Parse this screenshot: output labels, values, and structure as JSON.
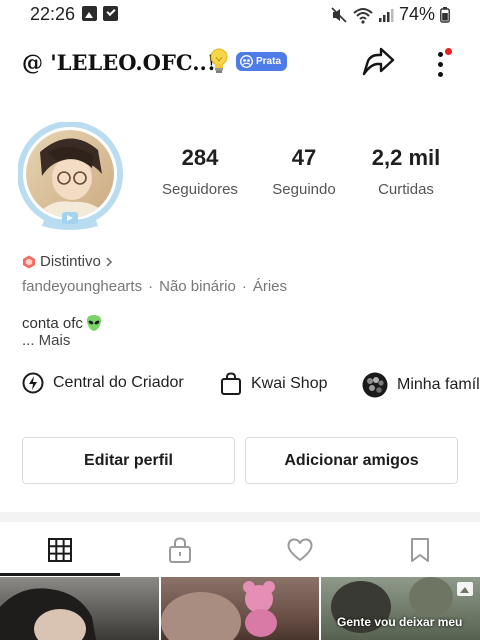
{
  "status_bar": {
    "time": "22:26",
    "battery": "74%"
  },
  "header": {
    "username": "@ 'LELEO.OFC..!",
    "badge_label": "Prata",
    "badge_color": "#4d7be8",
    "notification_color": "#e8211f"
  },
  "stats": [
    {
      "value": "284",
      "label": "Seguidores"
    },
    {
      "value": "47",
      "label": "Seguindo"
    },
    {
      "value": "2,2 mil",
      "label": "Curtidas"
    }
  ],
  "profile": {
    "distintivo": "Distintivo",
    "meta": [
      "fandeyounghearts",
      "Não binário",
      "Áries"
    ],
    "bio": "conta ofc",
    "bio_emoji_icon": "alien-emoji-icon",
    "more": "...  Mais"
  },
  "shortcuts": [
    {
      "label": "Central do Criador",
      "icon": "lightning-icon"
    },
    {
      "label": "Kwai Shop",
      "icon": "shopping-bag-icon"
    },
    {
      "label": "Minha família",
      "icon": "family-avatar-icon"
    }
  ],
  "buttons": {
    "edit_profile": "Editar perfil",
    "add_friends": "Adicionar amigos"
  },
  "tabs": [
    {
      "icon": "grid-icon",
      "selected": true
    },
    {
      "icon": "lock-icon",
      "selected": false
    },
    {
      "icon": "heart-icon",
      "selected": false
    },
    {
      "icon": "bookmark-icon",
      "selected": false
    }
  ],
  "thumbnails": [
    {
      "caption": ""
    },
    {
      "caption": ""
    },
    {
      "caption": "Gente vou deixar meu"
    }
  ]
}
